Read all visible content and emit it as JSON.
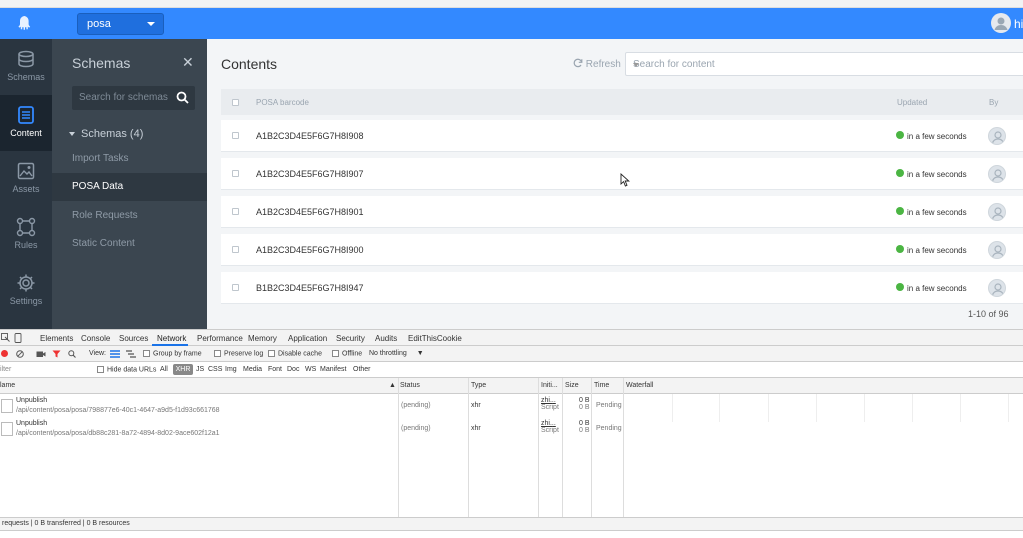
{
  "app": {
    "selected_app": "posa",
    "user_initials": "hi"
  },
  "nav": [
    {
      "label": "Schemas",
      "icon": "schemas-icon"
    },
    {
      "label": "Content",
      "icon": "content-icon"
    },
    {
      "label": "Assets",
      "icon": "assets-icon"
    },
    {
      "label": "Rules",
      "icon": "rules-icon"
    },
    {
      "label": "Settings",
      "icon": "settings-icon"
    }
  ],
  "schemas_panel": {
    "title": "Schemas",
    "search_placeholder": "Search for schemas",
    "group_label": "Schemas (4)",
    "items": [
      "Import Tasks",
      "POSA Data",
      "Role Requests",
      "Static Content"
    ]
  },
  "contents": {
    "title": "Contents",
    "refresh_label": "Refresh",
    "search_placeholder": "Search for content",
    "columns": {
      "barcode": "POSA barcode",
      "updated": "Updated",
      "by": "By"
    },
    "rows": [
      {
        "barcode": "A1B2C3D4E5F6G7H8I908",
        "updated": "in a few seconds"
      },
      {
        "barcode": "A1B2C3D4E5F6G7H8I907",
        "updated": "in a few seconds"
      },
      {
        "barcode": "A1B2C3D4E5F6G7H8I901",
        "updated": "in a few seconds"
      },
      {
        "barcode": "A1B2C3D4E5F6G7H8I900",
        "updated": "in a few seconds"
      },
      {
        "barcode": "B1B2C3D4E5F6G7H8I947",
        "updated": "in a few seconds"
      }
    ],
    "pager": "1-10 of 96"
  },
  "devtools": {
    "tabs": [
      "Elements",
      "Console",
      "Sources",
      "Network",
      "Performance",
      "Memory",
      "Application",
      "Security",
      "Audits",
      "EditThisCookie"
    ],
    "toolbar": {
      "view_label": "View:",
      "group_by_frame": "Group by frame",
      "preserve_log": "Preserve log",
      "disable_cache": "Disable cache",
      "offline": "Offline",
      "throttling": "No throttling"
    },
    "filter": {
      "placeholder": "ilter",
      "hide_data_urls": "Hide data URLs",
      "types": [
        "All",
        "XHR",
        "JS",
        "CSS",
        "Img",
        "Media",
        "Font",
        "Doc",
        "WS",
        "Manifest",
        "Other"
      ]
    },
    "columns": [
      "lame",
      "Status",
      "Type",
      "Initi...",
      "Size",
      "Time",
      "Waterfall"
    ],
    "requests": [
      {
        "name": "Unpublish",
        "path": "/api/content/posa/posa/798877e6-40c1-4647-a9d5-f1d93c661768",
        "status": "(pending)",
        "type": "xhr",
        "initiator": "zhi...",
        "initiator_sub": "Script",
        "size1": "0 B",
        "size2": "0 B",
        "time": "Pending"
      },
      {
        "name": "Unpublish",
        "path": "/api/content/posa/posa/db88c281-8a72-4894-8d02-9ace602f12a1",
        "status": "(pending)",
        "type": "xhr",
        "initiator": "zhi...",
        "initiator_sub": "Script",
        "size1": "0 B",
        "size2": "0 B",
        "time": "Pending"
      }
    ],
    "status_bar": "requests | 0 B transferred | 0 B resources"
  }
}
